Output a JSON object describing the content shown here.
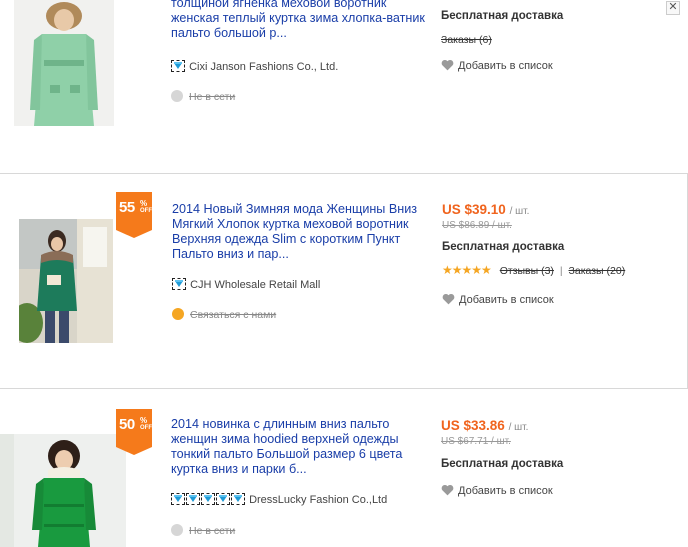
{
  "items": [
    {
      "title": "толщиной ягненка меховой воротник женская теплый куртка зима хлопка-ватник пальто большой р...",
      "seller": "Cixi Janson Fashions Co., Ltd.",
      "status": "Не в сети",
      "shipping": "Бесплатная доставка",
      "orders": "Заказы (6)",
      "wishlist": "Добавить в список",
      "close": "✕"
    },
    {
      "discount": "55",
      "discount_pct": "%",
      "discount_off": "OFF",
      "title": "2014 Новый Зимняя мода Женщины Вниз Мягкий Хлопок куртка меховой воротник Верхняя одежда Slim с коротким Пункт Пальто вниз и пар...",
      "seller": "CJH Wholesale Retail Mall",
      "status": "Связаться с нами",
      "price": "US $39.10",
      "unit": "/ шт.",
      "old_price": "US $86.89 / шт.",
      "shipping": "Бесплатная доставка",
      "stars": "★★★★★",
      "reviews": "Отзывы (3)",
      "separator": "|",
      "orders": "Заказы (20)",
      "wishlist": "Добавить в список"
    },
    {
      "discount": "50",
      "discount_pct": "%",
      "discount_off": "OFF",
      "title": "2014 новинка с длинным вниз пальто женщин зима hoodied верхней одежды тонкий пальто Большой размер 6 цвета куртка вниз и парки б...",
      "seller": "DressLucky Fashion Co.,Ltd",
      "status": "Не в сети",
      "price": "US $33.86",
      "unit": "/ шт.",
      "old_price": "US $67.71 / шт.",
      "shipping": "Бесплатная доставка",
      "wishlist": "Добавить в список"
    }
  ]
}
